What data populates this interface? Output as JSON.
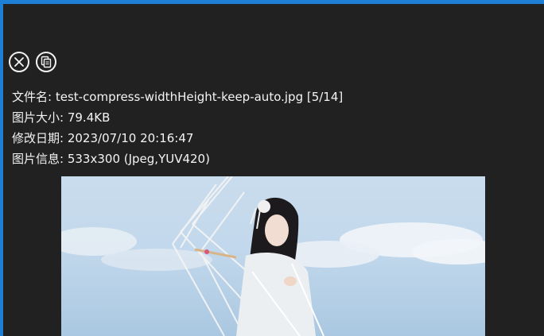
{
  "toolbar": {
    "close_icon": "close-circle-icon",
    "copy_icon": "copy-document-icon"
  },
  "info": {
    "filename_label": "文件名:",
    "filename_value": "test-compress-widthHeight-keep-auto.jpg [5/14]",
    "size_label": "图片大小:",
    "size_value": "79.4KB",
    "date_label": "修改日期:",
    "date_value": "2023/07/10 20:16:47",
    "meta_label": "图片信息:",
    "meta_value": "533x300 (Jpeg,YUV420)"
  },
  "colors": {
    "frame": "#1e7fd6",
    "background": "#212121",
    "text": "#f4f4f4"
  }
}
